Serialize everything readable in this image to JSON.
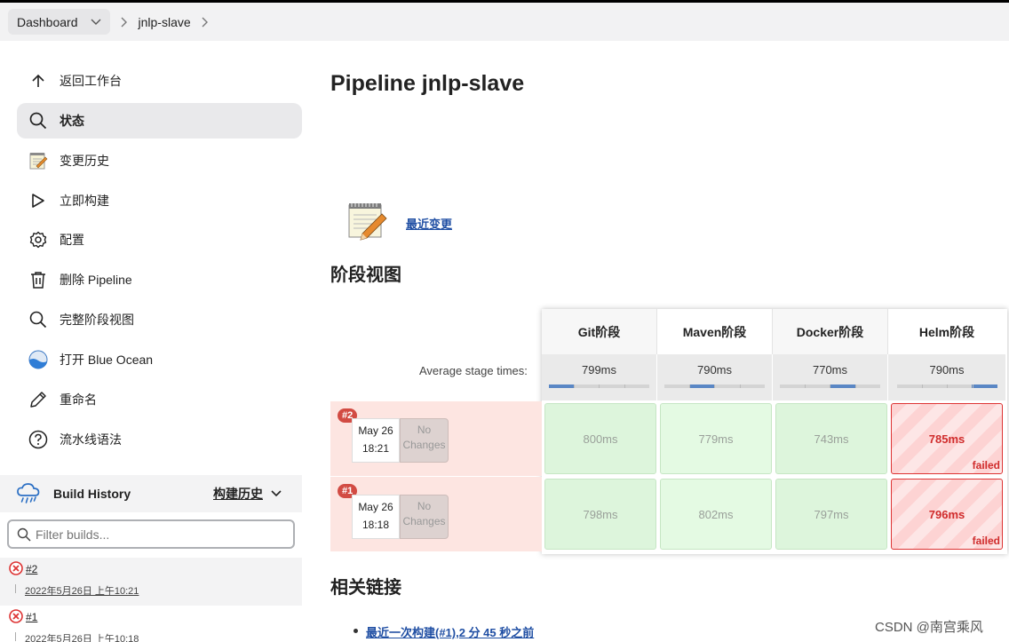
{
  "breadcrumb": {
    "dashboard": "Dashboard",
    "job": "jnlp-slave"
  },
  "sidebar": {
    "items": [
      {
        "label": "返回工作台",
        "icon": "arrow-up-icon"
      },
      {
        "label": "状态",
        "icon": "search-icon",
        "active": true
      },
      {
        "label": "变更历史",
        "icon": "notepad-icon"
      },
      {
        "label": "立即构建",
        "icon": "play-icon"
      },
      {
        "label": "配置",
        "icon": "gear-icon"
      },
      {
        "label": "删除 Pipeline",
        "icon": "trash-icon"
      },
      {
        "label": "完整阶段视图",
        "icon": "search-icon"
      },
      {
        "label": "打开 Blue Ocean",
        "icon": "blue-ocean-icon"
      },
      {
        "label": "重命名",
        "icon": "pencil-icon"
      },
      {
        "label": "流水线语法",
        "icon": "help-icon"
      }
    ]
  },
  "build_history": {
    "title": "Build History",
    "trend_label": "构建历史",
    "filter_placeholder": "Filter builds...",
    "builds": [
      {
        "number": "#2",
        "date": "2022年5月26日 上午10:21"
      },
      {
        "number": "#1",
        "date": "2022年5月26日 上午10:18"
      }
    ]
  },
  "main": {
    "title": "Pipeline jnlp-slave",
    "recent_changes": "最近变更",
    "stage_view_title": "阶段视图",
    "related_links_title": "相关链接",
    "related_links": [
      "最近一次构建(#1),2 分 45 秒之前"
    ]
  },
  "stage_view": {
    "avg_label": "Average stage times:",
    "stages": [
      {
        "name": "Git阶段",
        "avg": "799ms",
        "bar_start": 0.0,
        "bar_end": 0.25
      },
      {
        "name": "Maven阶段",
        "avg": "790ms",
        "bar_start": 0.25,
        "bar_end": 0.5
      },
      {
        "name": "Docker阶段",
        "avg": "770ms",
        "bar_start": 0.5,
        "bar_end": 0.75
      },
      {
        "name": "Helm阶段",
        "avg": "790ms",
        "bar_start": 0.75,
        "bar_end": 1.0
      }
    ],
    "runs": [
      {
        "badge": "#2",
        "date": "May 26",
        "time": "18:21",
        "changes": "No Changes",
        "cells": [
          "800ms",
          "779ms",
          "743ms",
          "785ms"
        ],
        "failed_label": "failed"
      },
      {
        "badge": "#1",
        "date": "May 26",
        "time": "18:18",
        "changes": "No Changes",
        "cells": [
          "798ms",
          "802ms",
          "797ms",
          "796ms"
        ],
        "failed_label": "failed"
      }
    ]
  },
  "watermark": "CSDN @南宫乘风",
  "colors": {
    "fail_red": "#d24b43",
    "success_green": "#ddf5dc",
    "link_blue": "#1f4ea3",
    "bar_blue": "#5a87c5"
  }
}
